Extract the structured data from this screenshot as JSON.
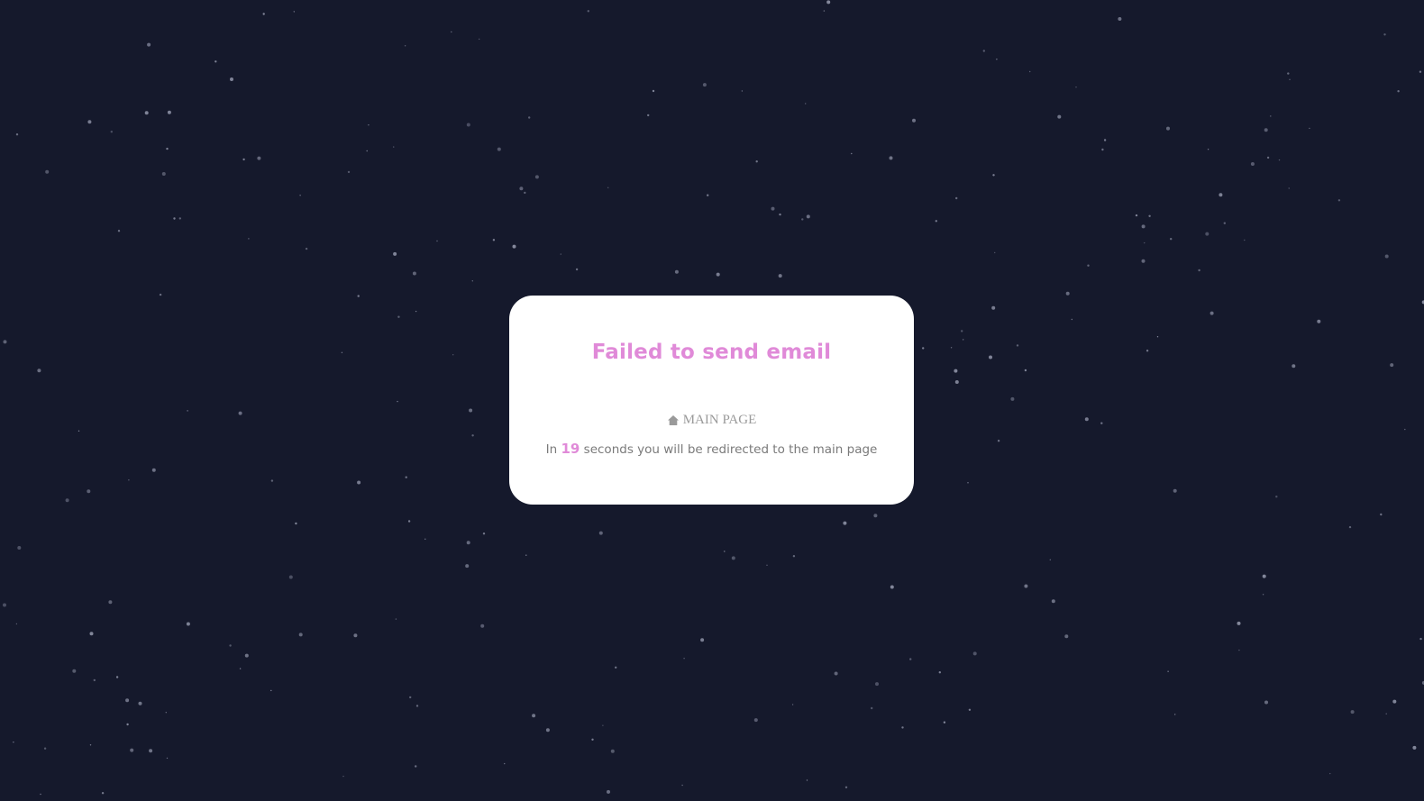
{
  "page": {
    "background_color": "#15192c",
    "star_color": "#8b8fa3"
  },
  "dialog": {
    "title": "Failed to send email",
    "accent_color": "#e08ad8",
    "home_link": {
      "icon": "home-icon",
      "label": "MAIN PAGE"
    },
    "redirect": {
      "prefix": "In",
      "seconds": "19",
      "suffix": "seconds you will be redirected to the main page"
    }
  }
}
